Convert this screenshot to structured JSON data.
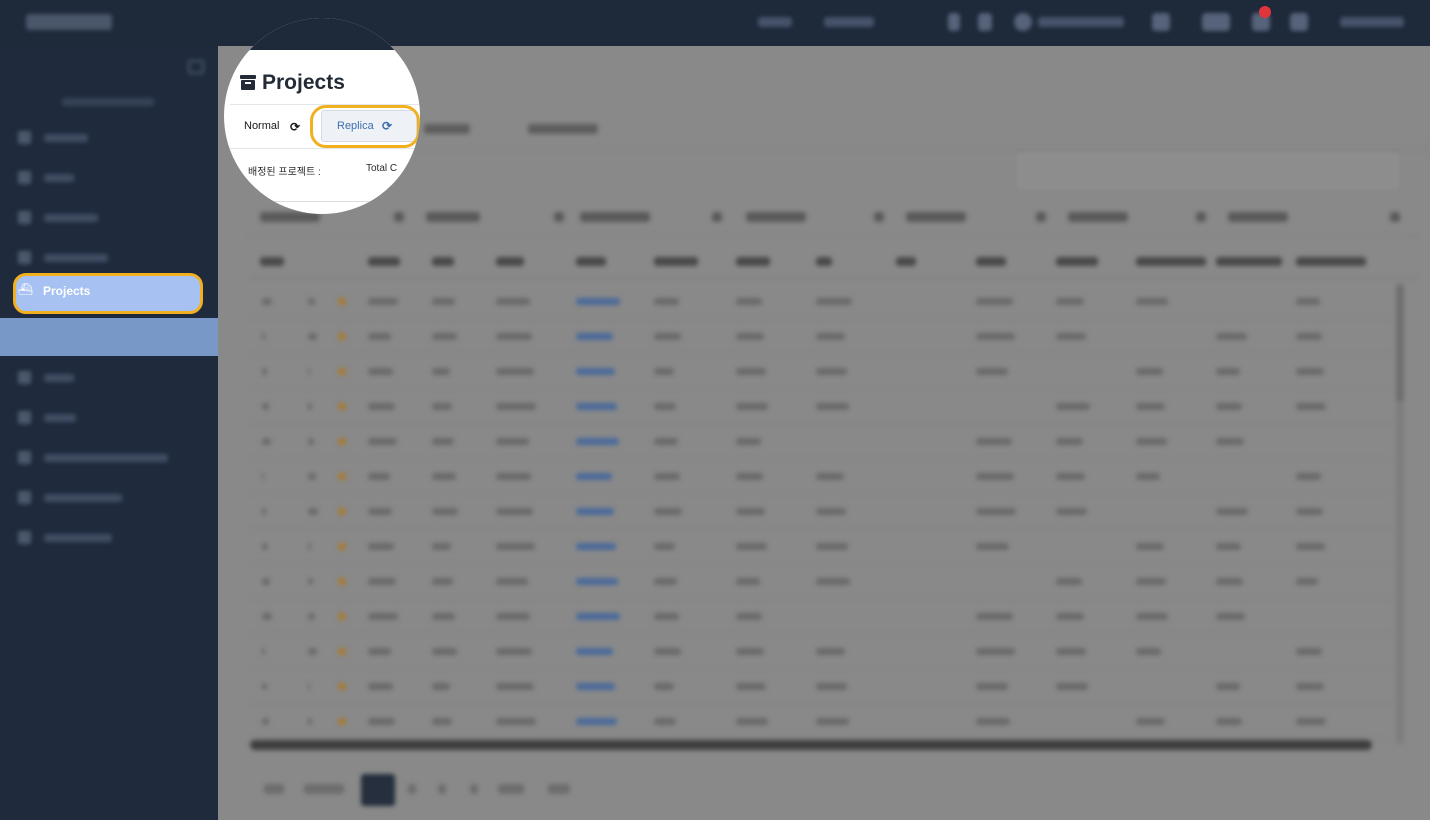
{
  "lens": {
    "title": "Projects",
    "tab_normal": "Normal",
    "tab_replica": "Replica",
    "refresh_glyph": "⟳",
    "assigned_projects_label": "배정된 프로젝트 :",
    "total_count_label": "Total C"
  },
  "sidebar": {
    "active_item": "Projects",
    "active_icon": "projects-icon"
  },
  "colors": {
    "highlight": "#f0b020",
    "sidebar_bg": "#1f2b3d",
    "active_item_bg": "#a7c2f2",
    "link": "#3d6fb0"
  },
  "notes_blurred": "Rest of page content is blurred/dimmed in the screenshot and not legible."
}
